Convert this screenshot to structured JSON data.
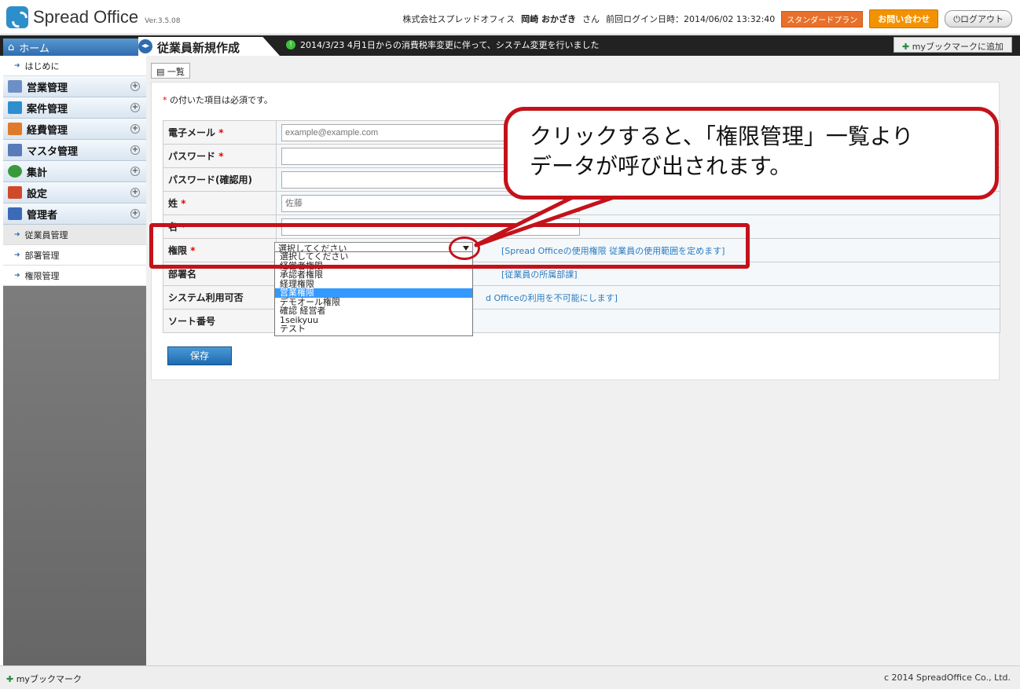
{
  "header": {
    "brand": "Spread Office",
    "version": "Ver.3.5.08",
    "company": "株式会社スプレッドオフィス",
    "user_name": "岡崎 おかざき",
    "honorific": "さん",
    "last_login": "前回ログイン日時：2014/06/02 13:32:40",
    "plan": "スタンダードプラン",
    "contact": "お問い合わせ",
    "logout": "ログアウト"
  },
  "titlebar": {
    "home": "ホーム",
    "page_title": "従業員新規作成",
    "notice": "2014/3/23 4月1日からの消費税率変更に伴って、システム変更を行いました",
    "bookmark_add": "myブックマークに追加"
  },
  "sidebar": {
    "intro": "はじめに",
    "items": [
      {
        "label": "営業管理",
        "color": "#6d8fc7"
      },
      {
        "label": "案件管理",
        "color": "#2e8fd0"
      },
      {
        "label": "経費管理",
        "color": "#e07a2a"
      },
      {
        "label": "マスタ管理",
        "color": "#5a7ab8"
      },
      {
        "label": "集計",
        "color": "#3a9a3a"
      },
      {
        "label": "設定",
        "color": "#d04a2a"
      },
      {
        "label": "管理者",
        "color": "#3a6ab8"
      }
    ],
    "sub_items": [
      "従業員管理",
      "部署管理",
      "権限管理"
    ]
  },
  "main": {
    "list_button": "一覧",
    "required_note": "の付いた項目は必須です。",
    "fields": {
      "email": {
        "label": "電子メール",
        "placeholder": "example@example.com"
      },
      "password": {
        "label": "パスワード"
      },
      "password_confirm": {
        "label": "パスワード(確認用)"
      },
      "last_name": {
        "label": "姓",
        "placeholder": "佐藤"
      },
      "first_name": {
        "label": "名"
      },
      "role": {
        "label": "権限",
        "hint": "[Spread Officeの使用権限 従業員の使用範囲を定めます]"
      },
      "department": {
        "label": "部署名",
        "hint": "[従業員の所属部課]"
      },
      "system_use": {
        "label": "システム利用可否",
        "hint": "d Officeの利用を不可能にします]"
      },
      "sort_no": {
        "label": "ソート番号"
      }
    },
    "role_select": {
      "selected": "選択してください",
      "options": [
        "選択してください",
        "経営者権限",
        "承認者権限",
        "経理権限",
        "営業権限",
        "デモオール権限",
        "確認 経営者",
        "1seikyuu",
        "テスト"
      ],
      "highlighted_index": 4
    },
    "save": "保存"
  },
  "callout": {
    "line1": "クリックすると、「権限管理」一覧より",
    "line2": "データが呼び出されます。"
  },
  "footer": {
    "bookmark": "myブックマーク",
    "copyright": "c 2014 SpreadOffice Co., Ltd."
  }
}
